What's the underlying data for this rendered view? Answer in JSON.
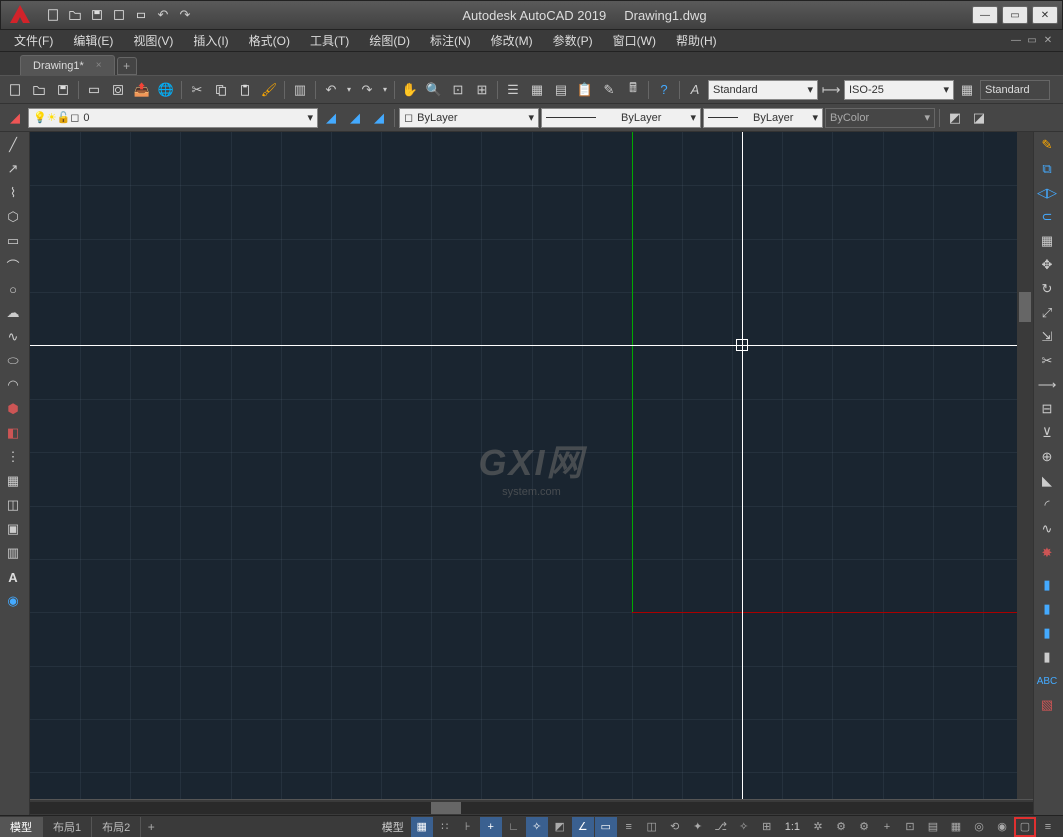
{
  "title": {
    "app": "Autodesk AutoCAD 2019",
    "doc": "Drawing1.dwg"
  },
  "menu": {
    "file": "文件(F)",
    "edit": "编辑(E)",
    "view": "视图(V)",
    "insert": "插入(I)",
    "format": "格式(O)",
    "tools": "工具(T)",
    "draw": "绘图(D)",
    "dim": "标注(N)",
    "modify": "修改(M)",
    "param": "参数(P)",
    "window": "窗口(W)",
    "help": "帮助(H)"
  },
  "filetab": {
    "name": "Drawing1*",
    "close": "×",
    "add": "+"
  },
  "styles": {
    "textstyle": "Standard",
    "dimstyle": "ISO-25",
    "tablestyle": "Standard"
  },
  "layers": {
    "current": "0"
  },
  "props": {
    "color_label": "ByLayer",
    "linetype_label": "ByLayer",
    "lineweight_label": "ByLayer",
    "plotstyle_label": "ByColor"
  },
  "watermark": {
    "big": "GXI网",
    "small": "system.com"
  },
  "layout": {
    "model": "模型",
    "l1": "布局1",
    "l2": "布局2",
    "add": "+"
  },
  "status": {
    "model": "模型",
    "scale": "1:1"
  }
}
